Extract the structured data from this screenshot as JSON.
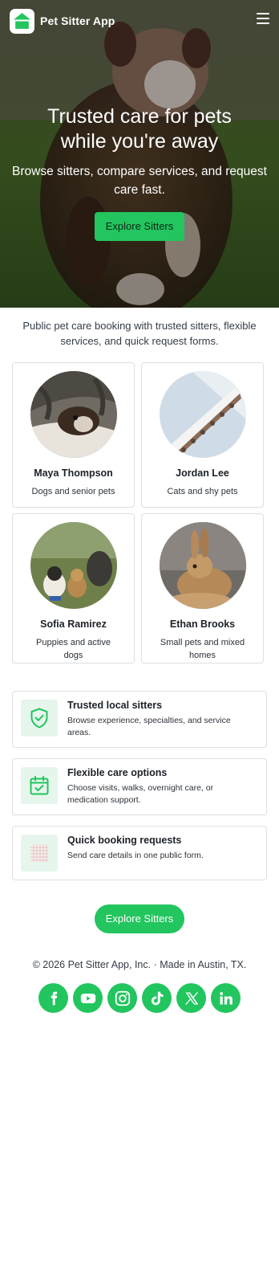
{
  "header": {
    "brand": "Pet Sitter App",
    "logo_icon": "house-icon",
    "menu_icon": "hamburger-menu-icon"
  },
  "hero": {
    "title": "Trusted care for pets while you're away",
    "subtitle": "Browse sitters, compare services, and request care fast.",
    "button_label": "Explore Sitters"
  },
  "intro": {
    "text": "Public pet care booking with trusted sitters, flexible services, and quick request forms."
  },
  "sitters": [
    {
      "name": "Maya Thompson",
      "specialty": "Dogs and senior pets"
    },
    {
      "name": "Jordan Lee",
      "specialty": "Cats and shy pets"
    },
    {
      "name": "Sofia Ramirez",
      "specialty": "Puppies and active dogs"
    },
    {
      "name": "Ethan Brooks",
      "specialty": "Small pets and mixed homes"
    }
  ],
  "features": [
    {
      "title": "Trusted local sitters",
      "desc": "Browse experience, specialties, and service areas.",
      "icon": "shield-check-icon"
    },
    {
      "title": "Flexible care options",
      "desc": "Choose visits, walks, overnight care, or medication support.",
      "icon": "calendar-check-icon"
    },
    {
      "title": "Quick booking requests",
      "desc": "Send care details in one public form.",
      "icon": "notepad-icon"
    }
  ],
  "cta": {
    "button_label": "Explore Sitters"
  },
  "footer": {
    "copyright": "© 2026 Pet Sitter App, Inc. · Made in Austin, TX.",
    "social": [
      "facebook-icon",
      "youtube-icon",
      "instagram-icon",
      "tiktok-icon",
      "x-icon",
      "linkedin-icon"
    ]
  },
  "colors": {
    "accent": "#22c55e",
    "accent_light": "#e7f6ec",
    "border": "#dcdfe3"
  }
}
